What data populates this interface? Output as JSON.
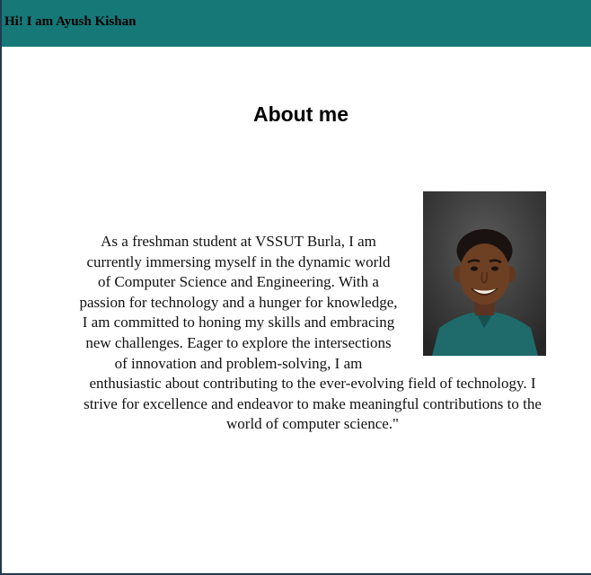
{
  "header": {
    "title": "Hi! I am Ayush Kishan",
    "background_color": "#177878"
  },
  "about": {
    "heading": "About me",
    "bio": "As a freshman student at VSSUT Burla, I am currently immersing myself in the dynamic world of Computer Science and Engineering. With a passion for technology and a hunger for knowledge, I am committed to honing my skills and embracing new challenges. Eager to explore the intersections of innovation and problem-solving, I am enthusiastic about contributing to the ever-evolving field of technology. I strive for excellence and endeavor to make meaningful contributions to the world of computer science.\"",
    "photo_icon": "profile-photo"
  }
}
